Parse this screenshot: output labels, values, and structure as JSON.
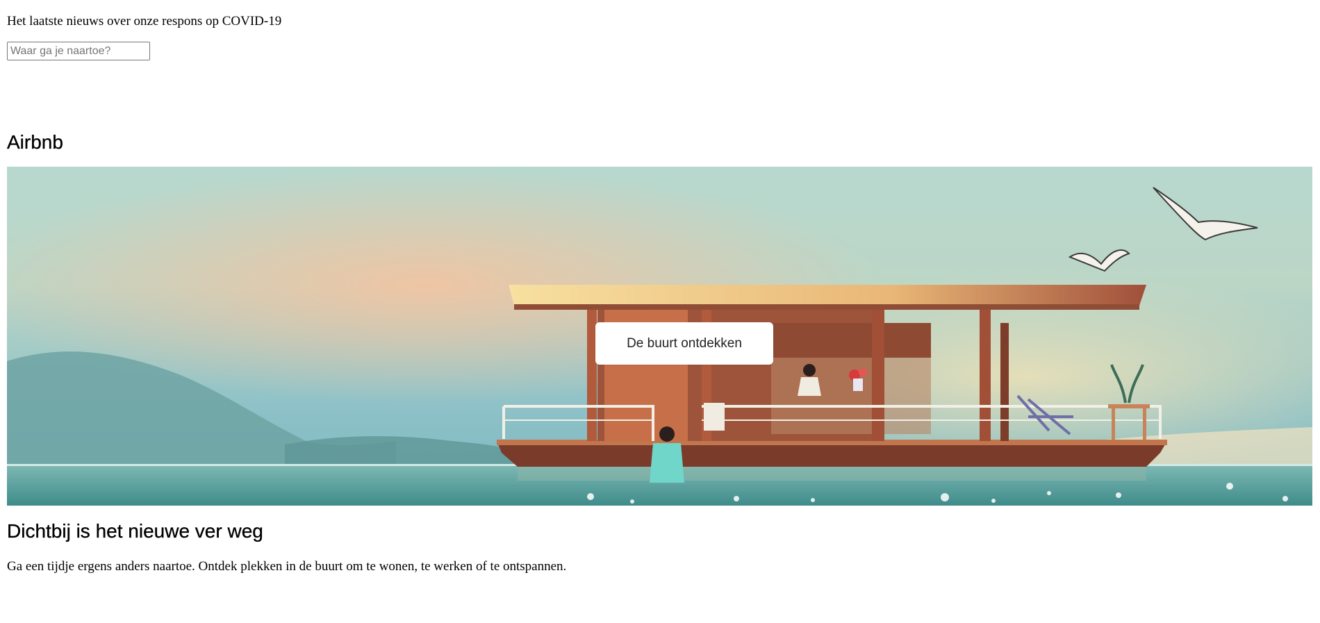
{
  "top_banner": {
    "covid_link": "Het laatste nieuws over onze respons op COVID-19"
  },
  "search": {
    "placeholder": "Waar ga je naartoe?",
    "value": ""
  },
  "brand": {
    "name": "Airbnb"
  },
  "hero": {
    "button_label": "De buurt ontdekken",
    "image_subject": "houseboat-on-lake-illustration"
  },
  "feature": {
    "headline": "Dichtbij is het nieuwe ver weg",
    "description": "Ga een tijdje ergens anders naartoe. Ontdek plekken in de buurt om te wonen, te werken of te ontspannen."
  },
  "colors": {
    "sky_top": "#a9cfc8",
    "sky_glow": "#f2c9a6",
    "water": "#5fa7a4",
    "roof": "#f3d48e",
    "house": "#a35a3c"
  }
}
